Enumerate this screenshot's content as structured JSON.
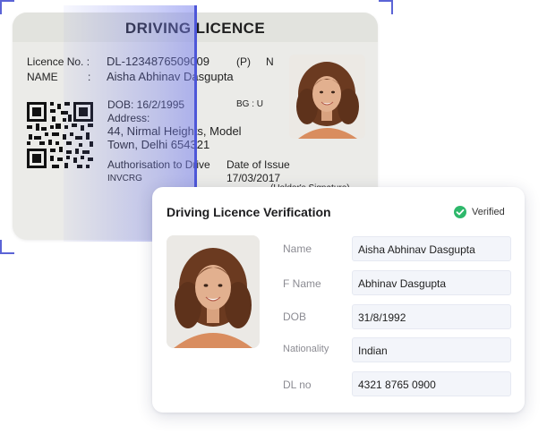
{
  "licence": {
    "title": "DRIVING LICENCE",
    "licence_no_label": "Licence No. :",
    "licence_no": "DL-1234876509009",
    "p_code": "(P)",
    "n_code": "N",
    "name_label": "NAME",
    "name_colon": ":",
    "name": "Aisha Abhinav Dasgupta",
    "dob": "DOB:  16/2/1995",
    "bg": "BG :  U",
    "address_label": "Address:",
    "address_line1": "44, Nirmal Heights, Model",
    "address_line2": "Town, Delhi 654321",
    "authorisation_label": "Authorisation to Drive",
    "issue_label": "Date of Issue",
    "class": "INVCRG",
    "issue_date": "17/03/2017",
    "signature_label": "(Holder's Signature)"
  },
  "verification": {
    "title": "Driving Licence Verification",
    "status": "Verified",
    "status_color": "#2eb86b",
    "fields": [
      {
        "label": "Name",
        "value": "Aisha Abhinav Dasgupta"
      },
      {
        "label": "F Name",
        "value": "Abhinav Dasgupta"
      },
      {
        "label": "DOB",
        "value": "31/8/1992"
      },
      {
        "label": "Nationality",
        "value": "Indian"
      },
      {
        "label": "DL no",
        "value": "4321 8765 0900"
      }
    ]
  },
  "icons": {
    "verified": "check-circle-icon",
    "qr": "qr-code-icon"
  },
  "accent_color": "#4d56d8"
}
